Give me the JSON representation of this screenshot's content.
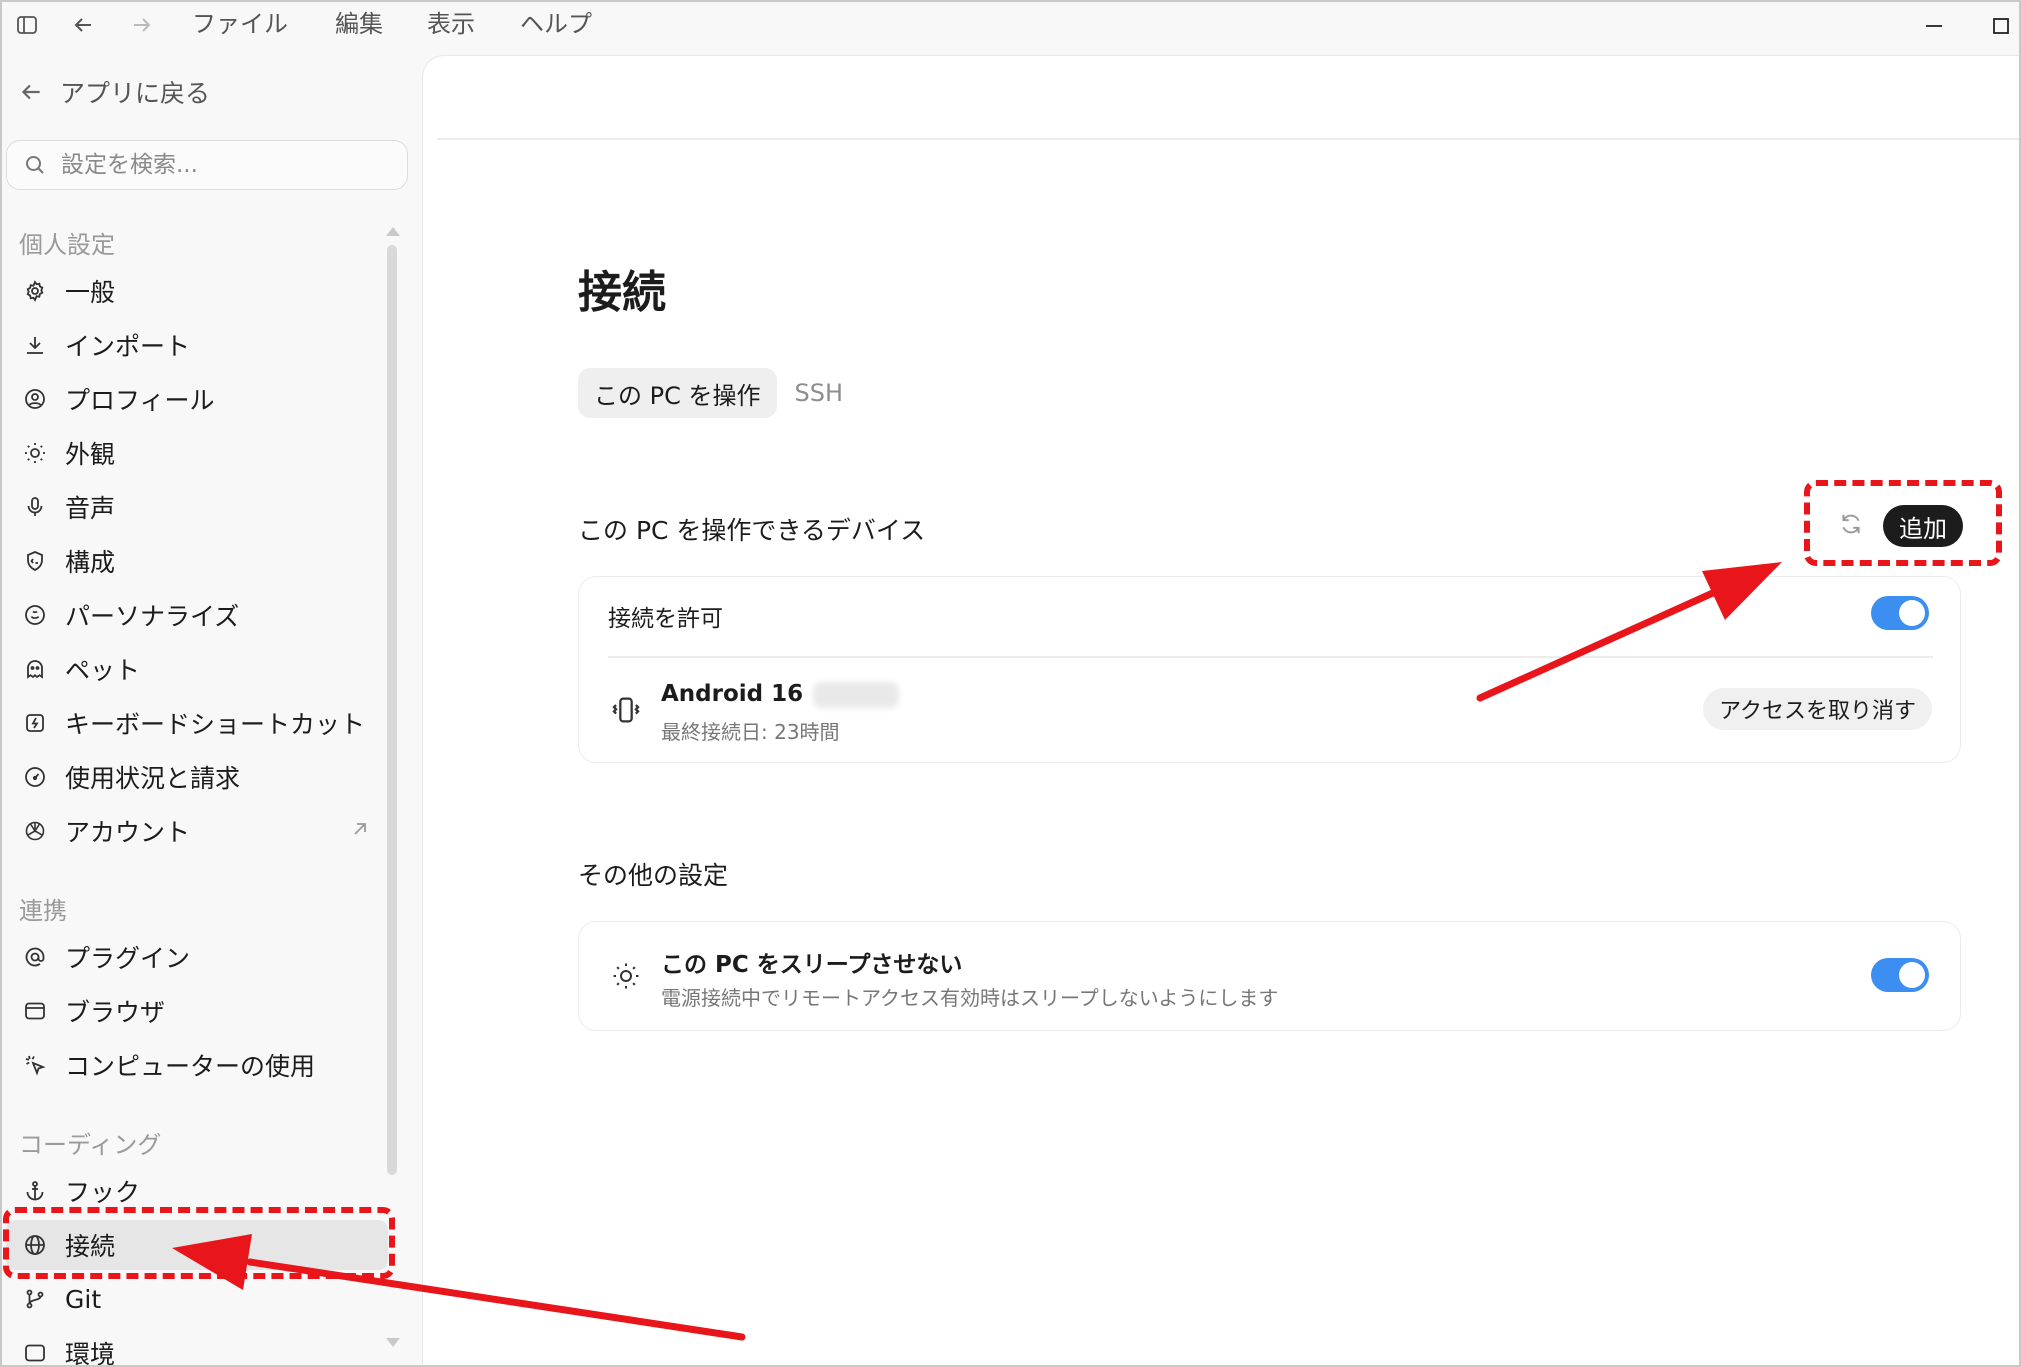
{
  "menu": {
    "file": "ファイル",
    "edit": "編集",
    "view": "表示",
    "help": "ヘルプ"
  },
  "sidebar": {
    "back_label": "アプリに戻る",
    "search_placeholder": "設定を検索...",
    "sections": {
      "personal": "個人設定",
      "integrations": "連携",
      "coding": "コーディング"
    },
    "items": {
      "general": "一般",
      "import": "インポート",
      "profile": "プロフィール",
      "appearance": "外観",
      "voice": "音声",
      "config": "構成",
      "personalize": "パーソナライズ",
      "pet": "ペット",
      "shortcuts": "キーボードショートカット",
      "usage": "使用状況と請求",
      "account": "アカウント",
      "plugins": "プラグイン",
      "browser": "ブラウザ",
      "computer_use": "コンピューターの使用",
      "hooks": "フック",
      "connections": "接続",
      "git": "Git",
      "environment": "環境"
    },
    "active_item": "connections"
  },
  "main": {
    "title": "接続",
    "tabs": [
      {
        "label": "この PC を操作",
        "active": true
      },
      {
        "label": "SSH",
        "active": false
      }
    ],
    "devices_section": {
      "title": "この PC を操作できるデバイス",
      "add_label": "追加",
      "allow_label": "接続を許可",
      "allow_enabled": true,
      "device": {
        "name": "Android 16",
        "last_connected": "最終接続日: 23時間",
        "revoke_label": "アクセスを取り消す"
      }
    },
    "other_section": {
      "title": "その他の設定",
      "sleep_title": "この PC をスリープさせない",
      "sleep_desc": "電源接続中でリモートアクセス有効時はスリープしないようにします",
      "sleep_enabled": true
    }
  },
  "colors": {
    "accent_toggle": "#3c8ef0",
    "annotation": "#e8161b",
    "dark_button": "#1c1c1c"
  }
}
